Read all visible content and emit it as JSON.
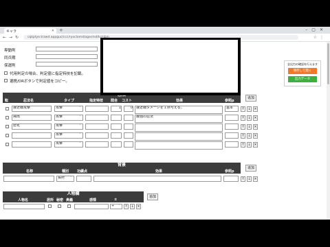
{
  "browser": {
    "tab_title": "キャラ",
    "url": "cqkptye.trawd.appguc/ccc/ryoclomd/agecmd/kr/nbm",
    "new_tab": "+"
  },
  "top_fields": [
    {
      "label": "専動則",
      "value": ""
    },
    {
      "label": "同兵期",
      "value": ""
    },
    {
      "label": "保運則",
      "value": ""
    }
  ],
  "checks": [
    {
      "label": "代用判定の場合、判定値に指定特技を記載。",
      "checked": false
    },
    {
      "label": "選携/DRボタンで判定値をコピー。",
      "checked": false
    }
  ],
  "ninpo": {
    "title": "忍法",
    "add_button": "追加",
    "headers": [
      "転",
      "忍法名",
      "タイプ",
      "指定特技",
      "間合",
      "コスト",
      "効果",
      "参照p"
    ],
    "rows": [
      {
        "name": "接近戦攻撃",
        "type": "攻撃",
        "skill": "",
        "range": "1",
        "cost": "0",
        "effect": "接近戦ダメージを１点与える。",
        "ref": "基本"
      },
      {
        "name": "飛出",
        "type": "攻撃",
        "skill": "",
        "range": "",
        "cost": "",
        "effect": "最強の忍法",
        "ref": ""
      },
      {
        "name": "怒化",
        "type": "攻撃",
        "skill": "",
        "range": "",
        "cost": "",
        "effect": "",
        "ref": ""
      },
      {
        "name": "",
        "type": "攻撃",
        "skill": "",
        "range": "",
        "cost": "",
        "effect": "",
        "ref": ""
      },
      {
        "name": "",
        "type": "攻撃",
        "skill": "",
        "range": "",
        "cost": "",
        "effect": "",
        "ref": ""
      }
    ]
  },
  "background": {
    "title": "背景",
    "add_button": "追加",
    "headers": [
      "名称",
      "種別",
      "功績点",
      "効果",
      "参照p"
    ],
    "rows": [
      {
        "name": "",
        "kind": "長所",
        "points": "",
        "effect": "",
        "ref": ""
      }
    ]
  },
  "personnel": {
    "title": "人物欄",
    "add_button": "追加",
    "headers": [
      "人物名",
      "居所",
      "秘密",
      "奥義",
      "感情",
      "±"
    ],
    "rows": [
      {
        "name": "",
        "emotion": "",
        "pm": "+"
      }
    ]
  },
  "side_panel": {
    "note": "全出力の確認を行えます",
    "btn1": "保存して開く",
    "btn2": "出力データ",
    "btn1_color": "#f07a2a",
    "btn2_color": "#3db03d"
  },
  "row_buttons": [
    "↑",
    "↓",
    "×"
  ],
  "select_arrow": "﹀"
}
